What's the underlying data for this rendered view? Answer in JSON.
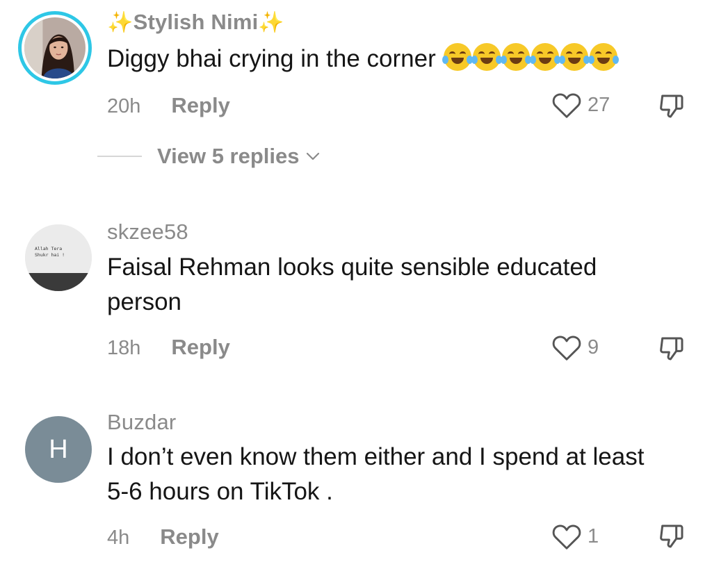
{
  "comments": [
    {
      "username": "Stylish Nimi",
      "username_decoration": "✨",
      "text": "Diggy bhai crying in the corner",
      "emoji": "😂😂😂😂😂😂",
      "time": "20h",
      "reply_label": "Reply",
      "likes": "27",
      "view_replies": "View 5 replies"
    },
    {
      "username": "skzee58",
      "avatar_text": "Allah Tera Shukr hai !",
      "text": "Faisal Rehman looks quite sensible educated person",
      "time": "18h",
      "reply_label": "Reply",
      "likes": "9"
    },
    {
      "username": "Buzdar",
      "avatar_letter": "H",
      "text": "I don’t even know them either and I spend at least 5-6 hours on TikTok .",
      "time": "4h",
      "reply_label": "Reply",
      "likes": "1"
    }
  ],
  "icons": {
    "like": "heart-outline-icon",
    "dislike": "thumbs-down-icon",
    "expand": "chevron-down-icon"
  },
  "colors": {
    "ring": "#2ec7e6",
    "muted_text": "#8a8a8a",
    "letter_avatar": "#7a8c97"
  }
}
